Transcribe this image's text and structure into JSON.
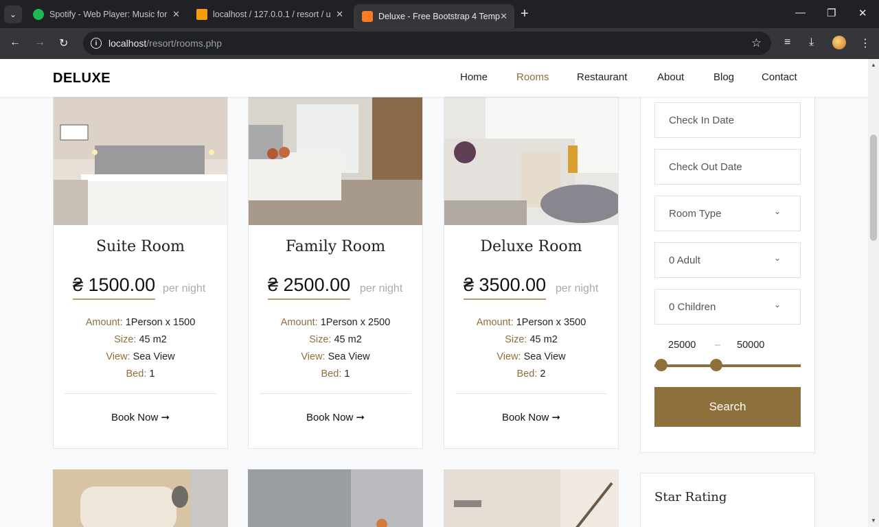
{
  "browser": {
    "tabs": [
      {
        "title": "Spotify - Web Player: Music for",
        "favicon": "spotify-icon",
        "color": "#1db954"
      },
      {
        "title": "localhost / 127.0.0.1 / resort / u",
        "favicon": "phpmyadmin-icon",
        "color": "#f89c0e"
      },
      {
        "title": "Deluxe - Free Bootstrap 4 Temp",
        "favicon": "xampp-icon",
        "color": "#fb7a24"
      }
    ],
    "url_host": "localhost",
    "url_path": "/resort/rooms.php"
  },
  "site": {
    "logo": "DELUXE",
    "nav": [
      "Home",
      "Rooms",
      "Restaurant",
      "About",
      "Blog",
      "Contact"
    ],
    "active_nav": "Rooms"
  },
  "rooms": [
    {
      "name": "Suite Room",
      "price": "₴ 1500.00",
      "per": "per night",
      "amount_label": "Amount:",
      "amount": "1Person x 1500",
      "size_label": "Size:",
      "size": "45 m2",
      "view_label": "View:",
      "view": "Sea View",
      "bed_label": "Bed:",
      "bed": "1",
      "book": "Book Now"
    },
    {
      "name": "Family Room",
      "price": "₴ 2500.00",
      "per": "per night",
      "amount_label": "Amount:",
      "amount": "1Person x 2500",
      "size_label": "Size:",
      "size": "45 m2",
      "view_label": "View:",
      "view": "Sea View",
      "bed_label": "Bed:",
      "bed": "1",
      "book": "Book Now"
    },
    {
      "name": "Deluxe Room",
      "price": "₴ 3500.00",
      "per": "per night",
      "amount_label": "Amount:",
      "amount": "1Person x 3500",
      "size_label": "Size:",
      "size": "45 m2",
      "view_label": "View:",
      "view": "Sea View",
      "bed_label": "Bed:",
      "bed": "2",
      "book": "Book Now"
    }
  ],
  "filters": {
    "check_in": "Check In Date",
    "check_out": "Check Out Date",
    "room_type": "Room Type",
    "adults": "0 Adult",
    "children": "0 Children",
    "range_min": "25000",
    "range_sep": "–",
    "range_max": "50000",
    "search": "Search",
    "star_rating": "Star Rating"
  },
  "colors": {
    "accent": "#8d703b"
  }
}
